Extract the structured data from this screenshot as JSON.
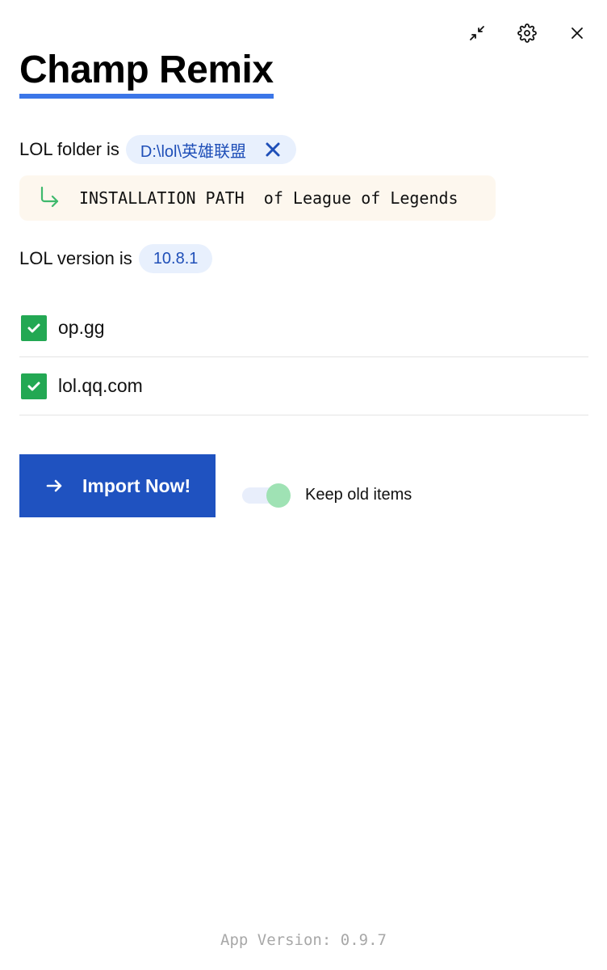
{
  "window_controls": {
    "minimize_icon": "collapse-arrows-icon",
    "settings_icon": "gear-icon",
    "close_icon": "close-icon"
  },
  "app": {
    "title": "Champ Remix"
  },
  "lol_folder": {
    "label": "LOL folder is",
    "value": "D:\\lol\\英雄联盟",
    "clear_icon": "close-icon"
  },
  "hint": {
    "icon": "turn-down-right-arrow-icon",
    "text": "INSTALLATION PATH  of League of Legends"
  },
  "lol_version": {
    "label": "LOL version is",
    "value": "10.8.1"
  },
  "sources": [
    {
      "label": "op.gg",
      "checked": true
    },
    {
      "label": "lol.qq.com",
      "checked": true
    }
  ],
  "import_button": {
    "label": "Import Now!",
    "icon": "arrow-right-icon"
  },
  "keep_old_items": {
    "label": "Keep old items",
    "enabled": true
  },
  "footer": {
    "app_version": "App Version: 0.9.7"
  },
  "colors": {
    "accent": "#3b76e8",
    "button": "#1f52c0",
    "chip_bg": "#e8f0fd",
    "chip_text": "#1f4fb8",
    "checkbox": "#23a853",
    "hint_bg": "#fdf7ee",
    "toggle_knob": "#9fe2b4"
  }
}
